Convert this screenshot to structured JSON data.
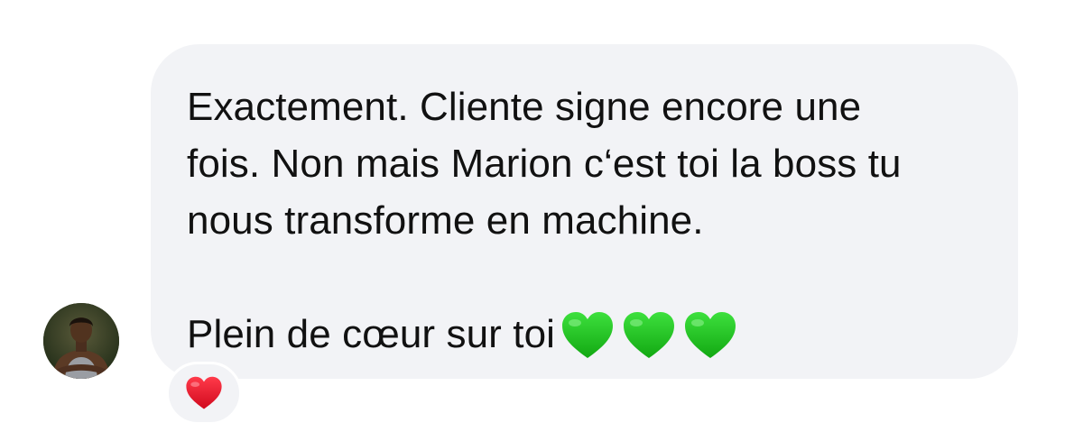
{
  "message": {
    "lines": [
      "Exactement. Cliente signe encore une",
      "fois. Non mais Marion c‘est toi la boss tu",
      "nous transforme en machine.",
      "",
      "Plein de cœur sur toi"
    ],
    "emoji": [
      "green-heart",
      "green-heart",
      "green-heart"
    ]
  },
  "reaction": {
    "emoji": "red-heart"
  },
  "colors": {
    "bubble": "#f2f3f6",
    "text": "#111111",
    "green_heart": "#2ec92e",
    "red_heart": "#e8132b"
  }
}
